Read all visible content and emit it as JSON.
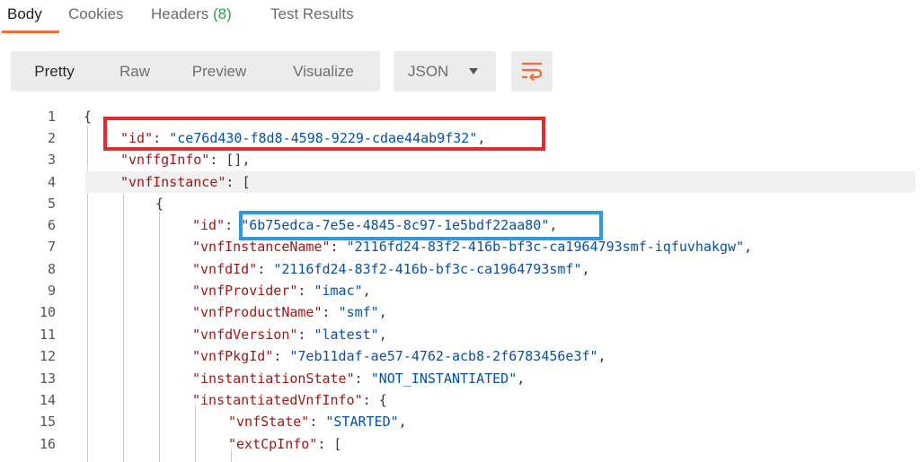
{
  "tabs": [
    {
      "label": "Body",
      "count": ""
    },
    {
      "label": "Cookies",
      "count": ""
    },
    {
      "label": "Headers",
      "count": "(8)"
    },
    {
      "label": "Test Results",
      "count": ""
    }
  ],
  "toolbar": {
    "views": [
      "Pretty",
      "Raw",
      "Preview",
      "Visualize"
    ],
    "active_view": "Pretty",
    "format": "JSON",
    "wrap_icon": "wrap-lines-icon"
  },
  "colors": {
    "accent": "#f26b3a",
    "key": "#a31515",
    "string": "#0451a5",
    "highlight_red": "#e02b2b",
    "highlight_blue": "#2f98e3"
  },
  "code": {
    "lines": [
      {
        "n": "1",
        "key": "",
        "value": "",
        "pre": "{",
        "post": ""
      },
      {
        "n": "2",
        "key": "\"id\"",
        "value": "\"ce76d430-f8d8-4598-9229-cdae44ab9f32\"",
        "pre": "",
        "post": ","
      },
      {
        "n": "3",
        "key": "\"vnffgInfo\"",
        "value": "",
        "pre": "",
        "post": ": [],"
      },
      {
        "n": "4",
        "key": "\"vnfInstance\"",
        "value": "",
        "pre": "",
        "post": ": ["
      },
      {
        "n": "5",
        "key": "",
        "value": "",
        "pre": "{",
        "post": ""
      },
      {
        "n": "6",
        "key": "\"id\"",
        "value": "\"6b75edca-7e5e-4845-8c97-1e5bdf22aa80\"",
        "pre": "",
        "post": ","
      },
      {
        "n": "7",
        "key": "\"vnfInstanceName\"",
        "value": "\"2116fd24-83f2-416b-bf3c-ca1964793smf-iqfuvhakgw\"",
        "pre": "",
        "post": ","
      },
      {
        "n": "8",
        "key": "\"vnfdId\"",
        "value": "\"2116fd24-83f2-416b-bf3c-ca1964793smf\"",
        "pre": "",
        "post": ","
      },
      {
        "n": "9",
        "key": "\"vnfProvider\"",
        "value": "\"imac\"",
        "pre": "",
        "post": ","
      },
      {
        "n": "10",
        "key": "\"vnfProductName\"",
        "value": "\"smf\"",
        "pre": "",
        "post": ","
      },
      {
        "n": "11",
        "key": "\"vnfdVersion\"",
        "value": "\"latest\"",
        "pre": "",
        "post": ","
      },
      {
        "n": "12",
        "key": "\"vnfPkgId\"",
        "value": "\"7eb11daf-ae57-4762-acb8-2f6783456e3f\"",
        "pre": "",
        "post": ","
      },
      {
        "n": "13",
        "key": "\"instantiationState\"",
        "value": "\"NOT_INSTANTIATED\"",
        "pre": "",
        "post": ","
      },
      {
        "n": "14",
        "key": "\"instantiatedVnfInfo\"",
        "value": "",
        "pre": "",
        "post": ": {"
      },
      {
        "n": "15",
        "key": "\"vnfState\"",
        "value": "\"STARTED\"",
        "pre": "",
        "post": ","
      },
      {
        "n": "16",
        "key": "\"extCpInfo\"",
        "value": "",
        "pre": "",
        "post": ": ["
      }
    ]
  }
}
